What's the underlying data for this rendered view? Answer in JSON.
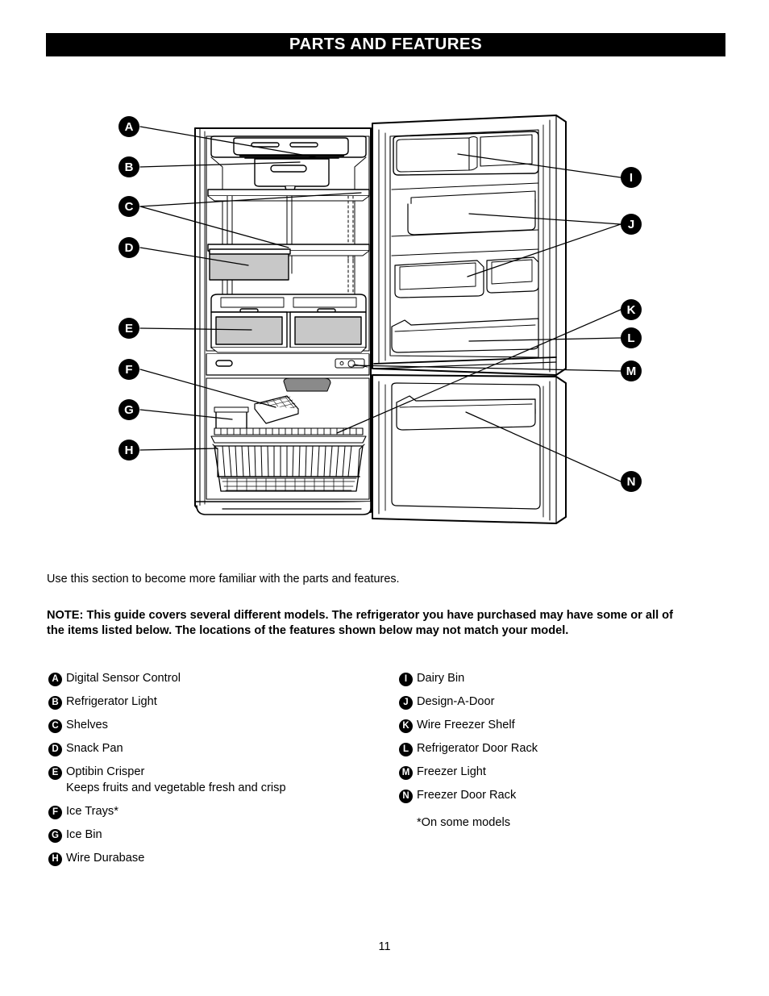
{
  "header": {
    "title": "PARTS AND FEATURES"
  },
  "body": {
    "intro": "Use this section to become more familiar with the parts and features.",
    "note": "NOTE: This guide covers several different models. The refrigerator you have purchased may have some or all of the items listed below. The locations of the features shown below may not match your model."
  },
  "legend": {
    "left": [
      {
        "key": "A",
        "label": "Digital Sensor Control",
        "sub": ""
      },
      {
        "key": "B",
        "label": "Refrigerator Light",
        "sub": ""
      },
      {
        "key": "C",
        "label": "Shelves",
        "sub": ""
      },
      {
        "key": "D",
        "label": "Snack Pan",
        "sub": ""
      },
      {
        "key": "E",
        "label": "Optibin Crisper",
        "sub": "Keeps fruits and vegetable fresh and crisp"
      },
      {
        "key": "F",
        "label": "Ice Trays*",
        "sub": ""
      },
      {
        "key": "G",
        "label": "Ice Bin",
        "sub": ""
      },
      {
        "key": "H",
        "label": "Wire Durabase",
        "sub": ""
      }
    ],
    "right": [
      {
        "key": "I",
        "label": "Dairy Bin",
        "sub": ""
      },
      {
        "key": "J",
        "label": "Design-A-Door",
        "sub": ""
      },
      {
        "key": "K",
        "label": "Wire Freezer Shelf",
        "sub": ""
      },
      {
        "key": "L",
        "label": "Refrigerator Door Rack",
        "sub": ""
      },
      {
        "key": "M",
        "label": "Freezer Light",
        "sub": ""
      },
      {
        "key": "N",
        "label": "Freezer Door Rack",
        "sub": ""
      }
    ],
    "footnote": "*On some models"
  },
  "diagram": {
    "callouts_left": [
      {
        "key": "A"
      },
      {
        "key": "B"
      },
      {
        "key": "C"
      },
      {
        "key": "D"
      },
      {
        "key": "E"
      },
      {
        "key": "F"
      },
      {
        "key": "G"
      },
      {
        "key": "H"
      }
    ],
    "callouts_right": [
      {
        "key": "I"
      },
      {
        "key": "J"
      },
      {
        "key": "K"
      },
      {
        "key": "L"
      },
      {
        "key": "M"
      },
      {
        "key": "N"
      }
    ]
  },
  "footer": {
    "page_number": "11"
  },
  "colors": {
    "header_bg": "#000000",
    "header_text": "#ffffff",
    "ink": "#000000",
    "paper": "#ffffff",
    "panel_fill": "#c8c8c8"
  }
}
